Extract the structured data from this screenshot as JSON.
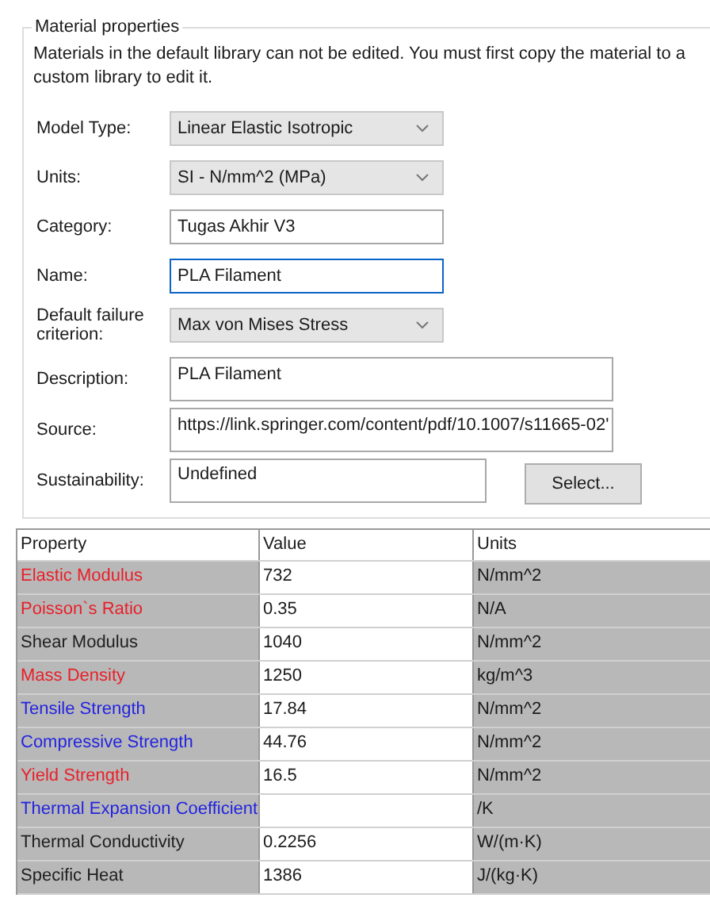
{
  "group": {
    "title": "Material properties",
    "note": "Materials in the default library can not be edited. You must first copy the material to a custom library to edit it."
  },
  "fields": [
    {
      "label": "Model Type:",
      "kind": "combo",
      "value": "Linear Elastic Isotropic",
      "focused": false
    },
    {
      "label": "Units:",
      "kind": "combo",
      "value": "SI - N/mm^2 (MPa)",
      "focused": false
    },
    {
      "label": "Category:",
      "kind": "text",
      "value": "Tugas Akhir V3",
      "focused": false
    },
    {
      "label": "Name:",
      "kind": "text",
      "value": "PLA Filament",
      "focused": true
    },
    {
      "label": "Default failure criterion:",
      "kind": "combo",
      "value": "Max von Mises Stress",
      "focused": false
    },
    {
      "label": "Description:",
      "kind": "memo",
      "value": "PLA Filament",
      "focused": false
    },
    {
      "label": "Source:",
      "kind": "memo",
      "value": "https://link.springer.com/content/pdf/10.1007/s11665-02'",
      "focused": false
    },
    {
      "label": "Sustainability:",
      "kind": "short",
      "value": "Undefined",
      "focused": false,
      "button": "Select..."
    }
  ],
  "table": {
    "columns": [
      "Property",
      "Value",
      "Units"
    ],
    "rows": [
      {
        "property": "Elastic Modulus",
        "color": "#e8202a",
        "value": "732",
        "units": "N/mm^2"
      },
      {
        "property": "Poisson`s Ratio",
        "color": "#e8202a",
        "value": "0.35",
        "units": "N/A"
      },
      {
        "property": "Shear Modulus",
        "color": "#202020",
        "value": "1040",
        "units": "N/mm^2"
      },
      {
        "property": "Mass Density",
        "color": "#e8202a",
        "value": "1250",
        "units": "kg/m^3"
      },
      {
        "property": "Tensile Strength",
        "color": "#2323e0",
        "value": "17.84",
        "units": "N/mm^2"
      },
      {
        "property": "Compressive Strength",
        "color": "#2323e0",
        "value": "44.76",
        "units": "N/mm^2"
      },
      {
        "property": "Yield Strength",
        "color": "#e8202a",
        "value": "16.5",
        "units": "N/mm^2"
      },
      {
        "property": "Thermal Expansion Coefficient",
        "color": "#2323e0",
        "value": "",
        "units": "/K"
      },
      {
        "property": "Thermal Conductivity",
        "color": "#202020",
        "value": "0.2256",
        "units": "W/(m·K)"
      },
      {
        "property": "Specific Heat",
        "color": "#202020",
        "value": "1386",
        "units": "J/(kg·K)"
      }
    ]
  }
}
